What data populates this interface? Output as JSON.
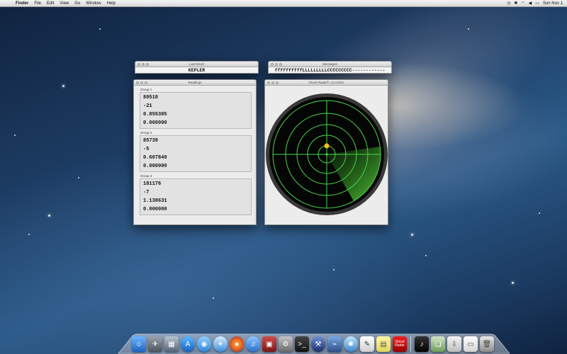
{
  "menubar": {
    "apple_glyph": "",
    "items": [
      "Finder",
      "File",
      "Edit",
      "View",
      "Go",
      "Window",
      "Help"
    ],
    "clock": "Sun Nov 1"
  },
  "windows": {
    "last_word": {
      "title": "Last Word",
      "value": "KEPLER"
    },
    "messages": {
      "title": "Messages",
      "value": "ffffffffffLLLLLLLLLCCCCCCCCC------------"
    },
    "readings": {
      "title": "Readings",
      "groups": [
        {
          "label": "Group 1",
          "values": [
            "80518",
            "-21",
            "0.855385",
            "0.000000"
          ]
        },
        {
          "label": "Group 2",
          "values": [
            "85739",
            "-5",
            "0.607840",
            "0.000000"
          ]
        },
        {
          "label": "Group 3",
          "values": [
            "181176",
            "-7",
            "1.138631",
            "0.000000"
          ]
        }
      ]
    },
    "radar": {
      "title": "Ghost Radar®: CLASSIC",
      "colors": {
        "grid": "#49d649",
        "sweep": "#4fc236",
        "blip": "#f2c21a",
        "screen": "#050505",
        "bezel": "#2e2e2e"
      }
    }
  },
  "dock": {
    "icons": [
      "finder-icon",
      "launchpad-icon",
      "mission-control-icon",
      "app-store-icon",
      "messages-icon",
      "safari-icon",
      "firefox-icon",
      "itunes-icon",
      "photo-booth-icon",
      "system-preferences-icon",
      "terminal-icon",
      "xcode-icon",
      "instruments-icon",
      "network-utility-icon",
      "textedit-icon",
      "stickies-icon",
      "ghost-radar-icon",
      "itunes-music-icon",
      "preview-icon",
      "downloads-icon",
      "documents-icon",
      "trash-icon"
    ],
    "ghost_radar_label": "Ghost Radar"
  }
}
